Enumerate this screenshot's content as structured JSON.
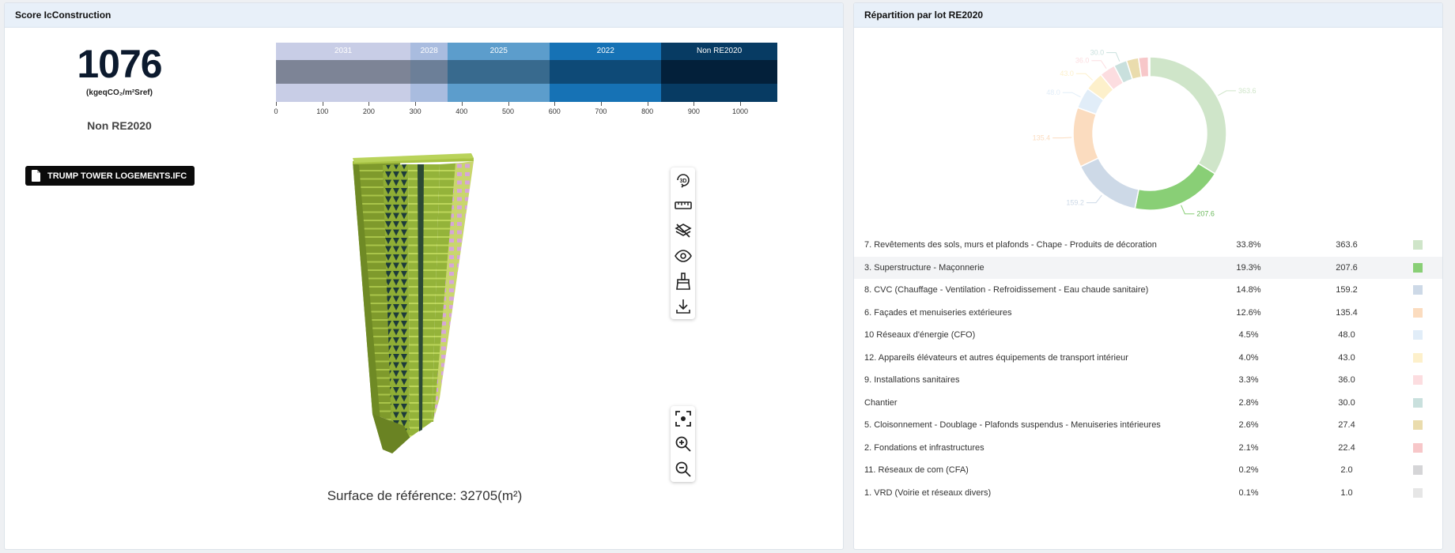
{
  "left_panel": {
    "title": "Score IcConstruction",
    "score": "1076",
    "unit": "(kgeqCO₂/m²Sref)",
    "classification": "Non RE2020",
    "file_name": "TRUMP TOWER LOGEMENTS.IFC",
    "surface_text": "Surface de référence: 32705(m²)",
    "scale": {
      "min": 0,
      "max": 1080,
      "segments": [
        {
          "label": "2031",
          "start": 0,
          "end": 290,
          "color": "#c8cde6",
          "mid_color": "#7d8496"
        },
        {
          "label": "2028",
          "start": 290,
          "end": 370,
          "color": "#a9bcdf",
          "mid_color": "#6c7f98"
        },
        {
          "label": "2025",
          "start": 370,
          "end": 590,
          "color": "#5c9dcc",
          "mid_color": "#386a8e"
        },
        {
          "label": "2022",
          "start": 590,
          "end": 830,
          "color": "#1672b5",
          "mid_color": "#0e4a77"
        },
        {
          "label": "Non RE2020",
          "start": 830,
          "end": 1080,
          "color": "#073b63",
          "mid_color": "#03203a"
        }
      ],
      "ticks": [
        "0",
        "100",
        "200",
        "300",
        "400",
        "500",
        "600",
        "700",
        "800",
        "900",
        "1000"
      ]
    },
    "tools_top": [
      "rotate-3d-icon",
      "ruler-icon",
      "hide-layers-icon",
      "eye-icon",
      "brush-icon",
      "download-icon"
    ],
    "tools_bottom": [
      "focus-icon",
      "zoom-in-icon",
      "zoom-out-icon"
    ]
  },
  "right_panel": {
    "title": "Répartition par lot RE2020",
    "donut_labels": [
      "363.6",
      "207.6",
      "159.2",
      "135.4",
      "48.0",
      "43.0",
      "36.0",
      "30.0"
    ],
    "rows": [
      {
        "name": "7. Revêtements des sols, murs et plafonds - Chape - Produits de décoration",
        "pct": "33.8%",
        "value": "363.6",
        "color": "#cfe5c9"
      },
      {
        "name": "3. Superstructure - Maçonnerie",
        "pct": "19.3%",
        "value": "207.6",
        "color": "#89cf76"
      },
      {
        "name": "8. CVC (Chauffage - Ventilation - Refroidissement - Eau chaude sanitaire)",
        "pct": "14.8%",
        "value": "159.2",
        "color": "#cdd9e7"
      },
      {
        "name": "6. Façades et menuiseries extérieures",
        "pct": "12.6%",
        "value": "135.4",
        "color": "#fbdcbf"
      },
      {
        "name": "10 Réseaux d'énergie (CFO)",
        "pct": "4.5%",
        "value": "48.0",
        "color": "#e1edf8"
      },
      {
        "name": "12. Appareils élévateurs et autres équipements de transport intérieur",
        "pct": "4.0%",
        "value": "43.0",
        "color": "#fdf0cb"
      },
      {
        "name": "9. Installations sanitaires",
        "pct": "3.3%",
        "value": "36.0",
        "color": "#fcdde0"
      },
      {
        "name": "Chantier",
        "pct": "2.8%",
        "value": "30.0",
        "color": "#c9e0dd"
      },
      {
        "name": "5. Cloisonnement - Doublage - Plafonds suspendus - Menuiseries intérieures",
        "pct": "2.6%",
        "value": "27.4",
        "color": "#eadcad"
      },
      {
        "name": "2. Fondations et infrastructures",
        "pct": "2.1%",
        "value": "22.4",
        "color": "#f7c7c9"
      },
      {
        "name": "11. Réseaux de com (CFA)",
        "pct": "0.2%",
        "value": "2.0",
        "color": "#d5d5d7"
      },
      {
        "name": "1. VRD (Voirie et réseaux divers)",
        "pct": "0.1%",
        "value": "1.0",
        "color": "#e6e6e6"
      }
    ],
    "highlighted_row": 1
  }
}
